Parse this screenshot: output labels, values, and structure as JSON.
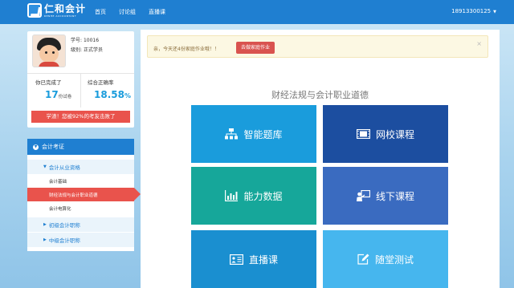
{
  "header": {
    "logo_cn": "仁和会计",
    "logo_en": "RENHE ACCOUNTANT",
    "nav": [
      "首页",
      "讨论组",
      "直播课"
    ],
    "user": "18913300125",
    "user_caret": "▼"
  },
  "profile": {
    "student_no_label": "学号:",
    "student_no": "10016",
    "level_label": "级别:",
    "level": "正式学员",
    "completed_label": "你已完成了",
    "completed_value": "17",
    "completed_unit": "份试卷",
    "accuracy_label": "综合正确率",
    "accuracy_value": "18.58",
    "accuracy_unit": "%",
    "ranking": "学渣！您被92%的考友击败了"
  },
  "tree": {
    "header": "会计考证",
    "section": "会计从业资格",
    "leaves": [
      "会计基础",
      "财经法规与会计职业道德",
      "会计电算化"
    ],
    "more": [
      "初级会计职称",
      "中级会计职称"
    ]
  },
  "main": {
    "notice": "亲，今天还4份家庭作业哦！！",
    "notice_button": "去做家庭作业",
    "close": "×",
    "subject": "财经法规与会计职业道德",
    "tiles": [
      {
        "label": "智能题库",
        "color": "#1a9cdc"
      },
      {
        "label": "网校课程",
        "color": "#1c4ea0"
      },
      {
        "label": "能力数据",
        "color": "#16a79a"
      },
      {
        "label": "线下课程",
        "color": "#3a6bc0"
      },
      {
        "label": "直播课",
        "color": "#1a8fd0"
      },
      {
        "label": "随堂测试",
        "color": "#46b6ee"
      }
    ]
  }
}
